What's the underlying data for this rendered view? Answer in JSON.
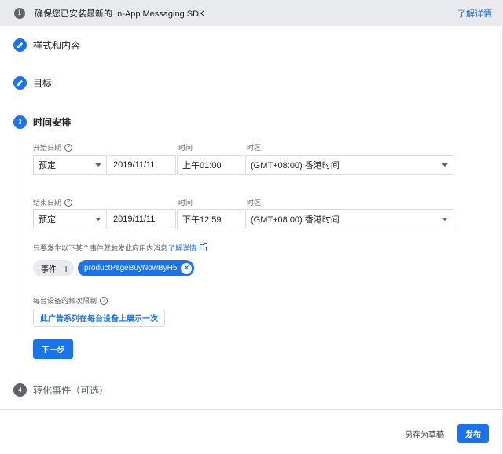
{
  "banner": {
    "icon": "info-icon",
    "text": "确保您已安装最新的 In-App Messaging SDK",
    "link": "了解详情"
  },
  "steps": [
    {
      "number": "",
      "icon": "pencil-icon",
      "label": "样式和内容",
      "state": "completed"
    },
    {
      "number": "",
      "icon": "pencil-icon",
      "label": "目标",
      "state": "completed"
    },
    {
      "number": "3",
      "label": "时间安排",
      "state": "active"
    },
    {
      "number": "4",
      "label": "转化事件（可选）",
      "state": "pending"
    }
  ],
  "schedule": {
    "start": {
      "label": "开始日期",
      "mode": "预定",
      "date": "2019/11/11",
      "time_label": "时间",
      "time": "上午01:00",
      "tz_label": "时区",
      "timezone": "(GMT+08:00) 香港时间"
    },
    "end": {
      "label": "结束日期",
      "mode": "预定",
      "date": "2019/11/11",
      "time_label": "时间",
      "time": "下午12:59",
      "tz_label": "时区",
      "timezone": "(GMT+08:00) 香港时间"
    },
    "trigger_text": "只要发生以下某个事件就触发此应用内消息",
    "trigger_link": "了解详情",
    "event_chip_label": "事件",
    "event_chip_plus": "+",
    "selected_event": "productPageBuyNowByH5",
    "frequency_label": "每台设备的频次限制",
    "frequency_button": "此广告系列在每台设备上展示一次",
    "next_button": "下一步"
  },
  "footer": {
    "draft_button": "另存为草稿",
    "publish_button": "发布"
  },
  "colors": {
    "accent": "#1a73e8",
    "banner_bg": "#e8eaed",
    "muted": "#5f6368"
  }
}
